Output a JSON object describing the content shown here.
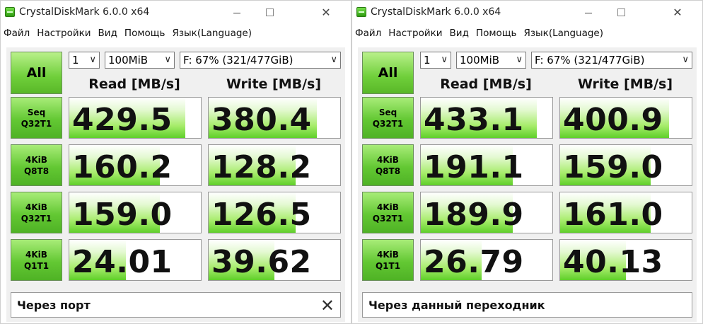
{
  "windows": [
    {
      "title": "CrystalDiskMark 6.0.0 x64",
      "menu": [
        "Файл",
        "Настройки",
        "Вид",
        "Помощь",
        "Язык(Language)"
      ],
      "all_label": "All",
      "count": "1",
      "size": "100MiB",
      "drive": "F: 67% (321/477GiB)",
      "read_header": "Read [MB/s]",
      "write_header": "Write [MB/s]",
      "rows": [
        {
          "label1": "Seq",
          "label2": "Q32T1",
          "read": "429.5",
          "write": "380.4",
          "read_fill": 0.88,
          "write_fill": 0.82
        },
        {
          "label1": "4KiB",
          "label2": "Q8T8",
          "read": "160.2",
          "write": "128.2",
          "read_fill": 0.69,
          "write_fill": 0.66
        },
        {
          "label1": "4KiB",
          "label2": "Q32T1",
          "read": "159.0",
          "write": "126.5",
          "read_fill": 0.69,
          "write_fill": 0.66
        },
        {
          "label1": "4KiB",
          "label2": "Q1T1",
          "read": "24.01",
          "write": "39.62",
          "read_fill": 0.43,
          "write_fill": 0.5
        }
      ],
      "comment": "Через порт",
      "comment_clear_icon": "✕"
    },
    {
      "title": "CrystalDiskMark 6.0.0 x64",
      "menu": [
        "Файл",
        "Настройки",
        "Вид",
        "Помощь",
        "Язык(Language)"
      ],
      "all_label": "All",
      "count": "1",
      "size": "100MiB",
      "drive": "F: 67% (321/477GiB)",
      "read_header": "Read [MB/s]",
      "write_header": "Write [MB/s]",
      "rows": [
        {
          "label1": "Seq",
          "label2": "Q32T1",
          "read": "433.1",
          "write": "400.9",
          "read_fill": 0.88,
          "write_fill": 0.83
        },
        {
          "label1": "4KiB",
          "label2": "Q8T8",
          "read": "191.1",
          "write": "159.0",
          "read_fill": 0.7,
          "write_fill": 0.69
        },
        {
          "label1": "4KiB",
          "label2": "Q32T1",
          "read": "189.9",
          "write": "161.0",
          "read_fill": 0.7,
          "write_fill": 0.69
        },
        {
          "label1": "4KiB",
          "label2": "Q1T1",
          "read": "26.79",
          "write": "40.13",
          "read_fill": 0.46,
          "write_fill": 0.5
        }
      ],
      "comment": "Через данный переходник"
    }
  ]
}
